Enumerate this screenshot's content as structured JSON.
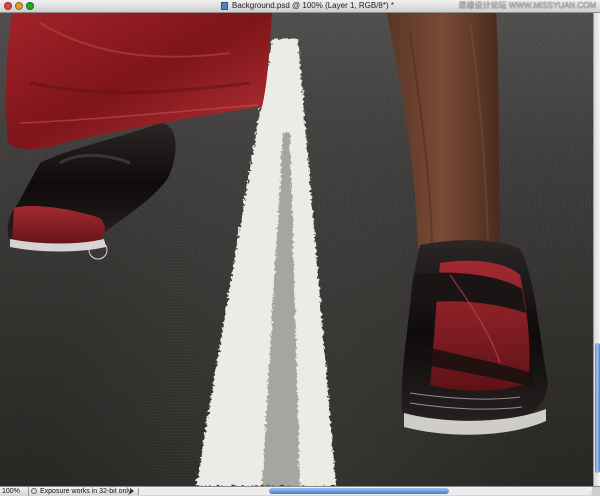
{
  "window": {
    "title": "Background.psd @ 100% (Layer 1, RGB/8*) *",
    "watermark": "思缘设计论坛 WWW.MISSYUAN.COM"
  },
  "statusbar": {
    "zoom": "100%",
    "message": "Exposure works in 32-bit only"
  },
  "icons": {
    "close": "close-button",
    "minimize": "minimize-button",
    "zoom": "zoom-button",
    "document": "psd-document-icon",
    "info": "info-icon",
    "brush_cursor": "circle-brush-cursor-icon"
  },
  "colors": {
    "shorts": "#8e1c22",
    "shoe_red": "#8a1e24",
    "road_line": "#ecebe6",
    "asphalt": "#3d3b38",
    "scroll_accent": "#5f8fd8"
  }
}
